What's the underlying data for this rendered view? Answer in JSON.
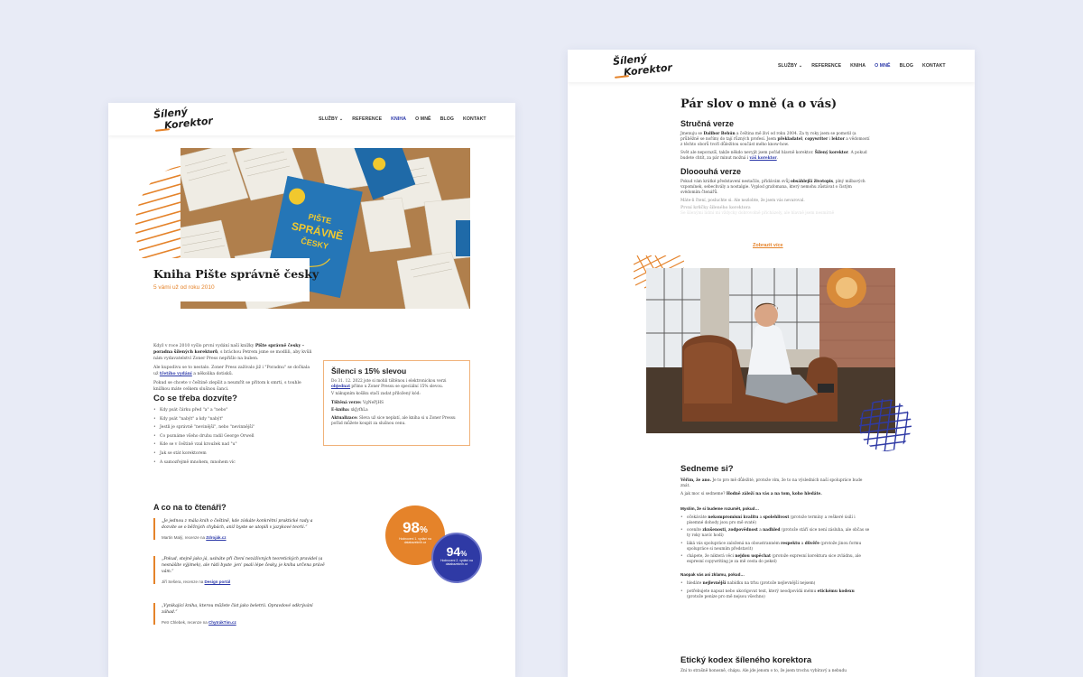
{
  "brand": {
    "logo_line1": "Šílený",
    "logo_line2": "Korektor",
    "accent": "#e5832a",
    "blue": "#2a37a8"
  },
  "nav": {
    "items": [
      "SLUŽBY",
      "REFERENCE",
      "KNIHA",
      "O MNĚ",
      "BLOG",
      "KONTAKT"
    ],
    "dropdown_icon": "chevron-down-icon"
  },
  "left": {
    "hero": {
      "title": "Kniha Pište správně česky",
      "subtitle": "5 vámi už od roku 2010",
      "book_cover_title": "PIŠTE SPRÁVNĚ ČESKY"
    },
    "intro": {
      "p1_a": "Když v roce 2010 vyšlo první vydání naší knížky ",
      "p1_b1": "Pište správně česky – poradna šílených korektorů",
      "p1_c": ", s bráchou Petrem jsme se modlili, aby kvůli nám vydavatelství Zoner Press nepřišlo na buben.",
      "p2_a": "Ale kupodivu se to nestalo. Zoner Press zažívalo již i \"Poradnu\" se dočkala už ",
      "p2_link": "třetího vydání",
      "p2_b": " a několika dotisků.",
      "p3": "Pokud se chcete v češtině zlepšit a neumřít se přitom k smrti, s touhle knížkou máte celkem slušnou šanci."
    },
    "learn": {
      "heading": "Co se třeba dozvíte?",
      "items": [
        "Kdy psát čárku před \"a\" a \"nebo\"",
        "Kdy psát \"nabýt\" a kdy \"nabýt\"",
        "Jestli je správně \"nevinější\", nebo \"nevinnější\"",
        "Co poznáme všeho druhu radil George Orwell",
        "Kde se v češtině vzal kroužek nad \"u\"",
        "Jak se stát korektorem",
        "A samozřejmě mnohem, mnohem víc"
      ]
    },
    "offer": {
      "heading": "Šílenci s 15% slevou",
      "p1_a": "Do 31. 12. 2022 jste si mohli tištěnou i elektronickou verzi ",
      "p1_link": "objednat",
      "p1_b": " přímo u Zoner Pressu se speciální 15% slevou.",
      "p2": "V nákupním košíku stačí zadat přiložený kód:",
      "print_label": "Tištěná verze:",
      "print_code": "VgNePjHS",
      "ebook_label": "E-kniha:",
      "ebook_code": "xkJyfhLa",
      "update_label": "Aktualizace:",
      "update_text": " Sleva už sice neplatí, ale kniha si u Zoner Pressu pořád můžete koupit za slušnou cenu."
    },
    "readers": {
      "heading": "A co na to čtenáři?",
      "quotes": [
        {
          "text": "„Je jednou z mála knih o češtině, kde získáte konkrétní praktické rady a dozvíte se o běžných chybách, aniž byste se utopili v jazykové teorii.“",
          "author": "Martin Malý, recenze na ",
          "source": "Zdroják.cz"
        },
        {
          "text": "„Pokud, stejně jako já, usínáte při čtení nezáživných teoretických pravidel (a nesnášíte výjimek), ale rádi byste ‚jen‘ psali lépe česky, je kniha určena právě vám.“",
          "author": "Jiří Sešera, recenze na ",
          "source": "Design portál"
        },
        {
          "text": "„Vynikající kniha, kterou můžete číst jako beletrii. Opravdové odkrývání záhad.“",
          "author": "Petr Chlebek, recenze na ",
          "source": "ChytrákTim.cz"
        }
      ],
      "badges": [
        {
          "pct": "98",
          "sign": "%",
          "text": "Hodnocení 1. vydání na databazeknih.cz",
          "color": "#e5832a"
        },
        {
          "pct": "94",
          "sign": "%",
          "text": "Hodnocení 2. vydání na databazeknih.cz",
          "color": "#2f3aa5"
        }
      ]
    }
  },
  "right": {
    "title": "Pár slov o mně (a o vás)",
    "short": {
      "heading": "Stručná verze",
      "p1_a": "Jmenuju se ",
      "p1_name": "Dalibor Behún",
      "p1_b": " a čeština mě živí od roku 2004. Za ty roky jsem se pomotil (a průběžně se nořím) do tají různých profesí. Jsem ",
      "p1_r1": "překladatel",
      "p1_c": ", ",
      "p1_r2": "copywriter",
      "p1_d": " i ",
      "p1_r3": "lektor",
      "p1_e": " a vědomostí z těchto oborů tvoří důležitou součást mého know-how.",
      "p2_a": "Svět ale neporazíš, takže někdo nevyjít jsem pořád hlavně korektor. ",
      "p2_b": "Šílený korektor",
      "p2_c": ". A pokud budete chtít, za pár minut možná i ",
      "p2_link": "váš korektor",
      "p2_d": "."
    },
    "long": {
      "heading": "Dlooouhá verze",
      "p1_a": "Pokud vám krátké představení nestačilo, přidávám svůj ",
      "p1_b": "obsáhlejší životopis",
      "p1_c": ", plný milbavých vzpomínek, sebechvály a nostalgie. Vyplod grafomana, který nemohu zůstávat o čistým svědomím čtenářů.",
      "p2": "Máte-li čtení, posluchte si. Ale nezlobte, že jsem vás nevaroval.",
      "p3": "První krůčky šíleného korektora",
      "p4": "Se šílenými lidmi mi vždycky dobrovolně přicházely, ale hlavně jsem nesmírně",
      "more": "Zobrazit více"
    },
    "meet": {
      "heading": "Sedneme si?",
      "p1_a": "Věřím, že ano.",
      "p1_b": " Je to pro mě důležité, protože vím, že to na výsledních naší spolupráce bude znát.",
      "p2_a": "A jak moc si sedneme? ",
      "p2_b": "Hodně záleží na vás a na tom, koho hledáte.",
      "understand_heading": "Myslím, že si budeme rozumět, pokud…",
      "understand_items": [
        {
          "a": "očekáváte ",
          "b": "nekompromisní kvalitu",
          "c": " a ",
          "d": "spolehlivost",
          "e": " (protože termíny a veškeré úsilí i písemné dohody jsou pro mě svaté)"
        },
        {
          "a": "oceníte ",
          "b": "zkušenosti, zodpovědnost",
          "c": " a ",
          "d": "nadhled",
          "e": " (protože stáří sice není zásluha, ale občas se ty roky navíc hodí)"
        },
        {
          "a": "láká vás spolupráce založená na oboustranném ",
          "b": "respektu",
          "c": " a ",
          "d": "důvěře",
          "e": " (protože jinou formu spolupráce si neumím představit)"
        },
        {
          "a": "chápete, že nikterá věci ",
          "b": "nejdou uspěchat",
          "c": "",
          "d": "",
          "e": " (protože expresní korektura sice zvládnu, ale expresní copywriting je za mě cesta do pekel)"
        }
      ],
      "avoid_heading": "Naopak vás asi zklamu, pokud…",
      "avoid_items": [
        {
          "a": "hledáte ",
          "b": "nejlevnější",
          "c": " nabídku na trhu (protože nejlevnější nejsem)",
          "d": "",
          "e": ""
        },
        {
          "a": "potřebujete napsat nebo ukorigovat text, který neodpovídá mému ",
          "b": "etickému kodexu",
          "c": " (protože peníze pro mě nejsou všechno)",
          "d": "",
          "e": ""
        }
      ]
    },
    "ethics": {
      "heading": "Etický kodex šíleného korektora",
      "p1": "Zní to strašně honosně, chápu. Ale jde jenom o to, že jsem trochu vybíravý a nebudu"
    }
  }
}
